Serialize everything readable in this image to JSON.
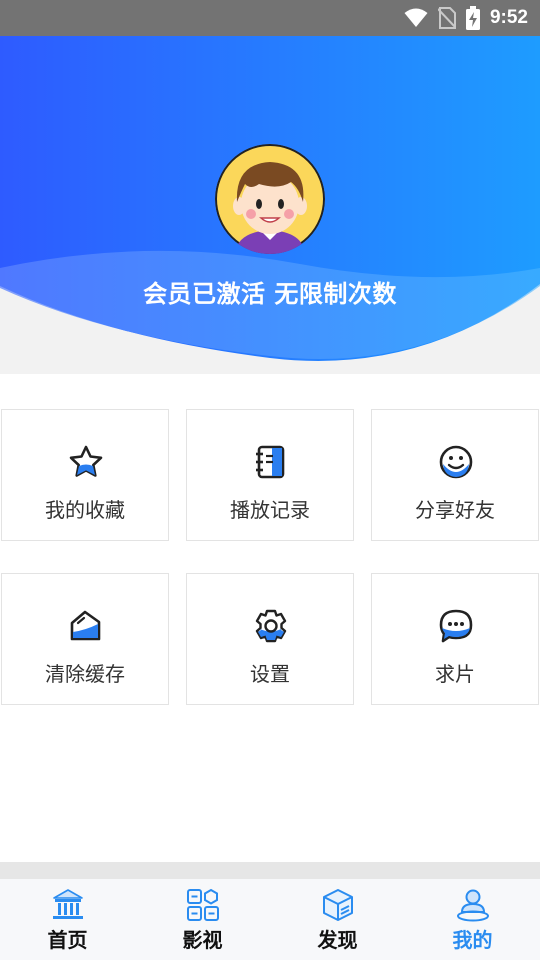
{
  "status_bar": {
    "time": "9:52",
    "icons": [
      "wifi-icon",
      "no-sim-icon",
      "battery-charging-icon"
    ]
  },
  "header": {
    "membership_text": "会员已激活 无限制次数",
    "gradient_colors": [
      "#2e5bff",
      "#1e9cff"
    ]
  },
  "menu": {
    "items": [
      {
        "label": "我的收藏",
        "icon": "star-icon"
      },
      {
        "label": "播放记录",
        "icon": "notebook-icon"
      },
      {
        "label": "分享好友",
        "icon": "smiley-icon"
      },
      {
        "label": "清除缓存",
        "icon": "broom-icon"
      },
      {
        "label": "设置",
        "icon": "gear-icon"
      },
      {
        "label": "求片",
        "icon": "chat-bubble-icon"
      }
    ]
  },
  "tab_bar": {
    "tabs": [
      {
        "label": "首页",
        "icon": "home-building-icon",
        "active": false
      },
      {
        "label": "影视",
        "icon": "grid-apps-icon",
        "active": false
      },
      {
        "label": "发现",
        "icon": "cube-icon",
        "active": false
      },
      {
        "label": "我的",
        "icon": "user-icon",
        "active": true
      }
    ],
    "active_color": "#2a8cf0"
  }
}
